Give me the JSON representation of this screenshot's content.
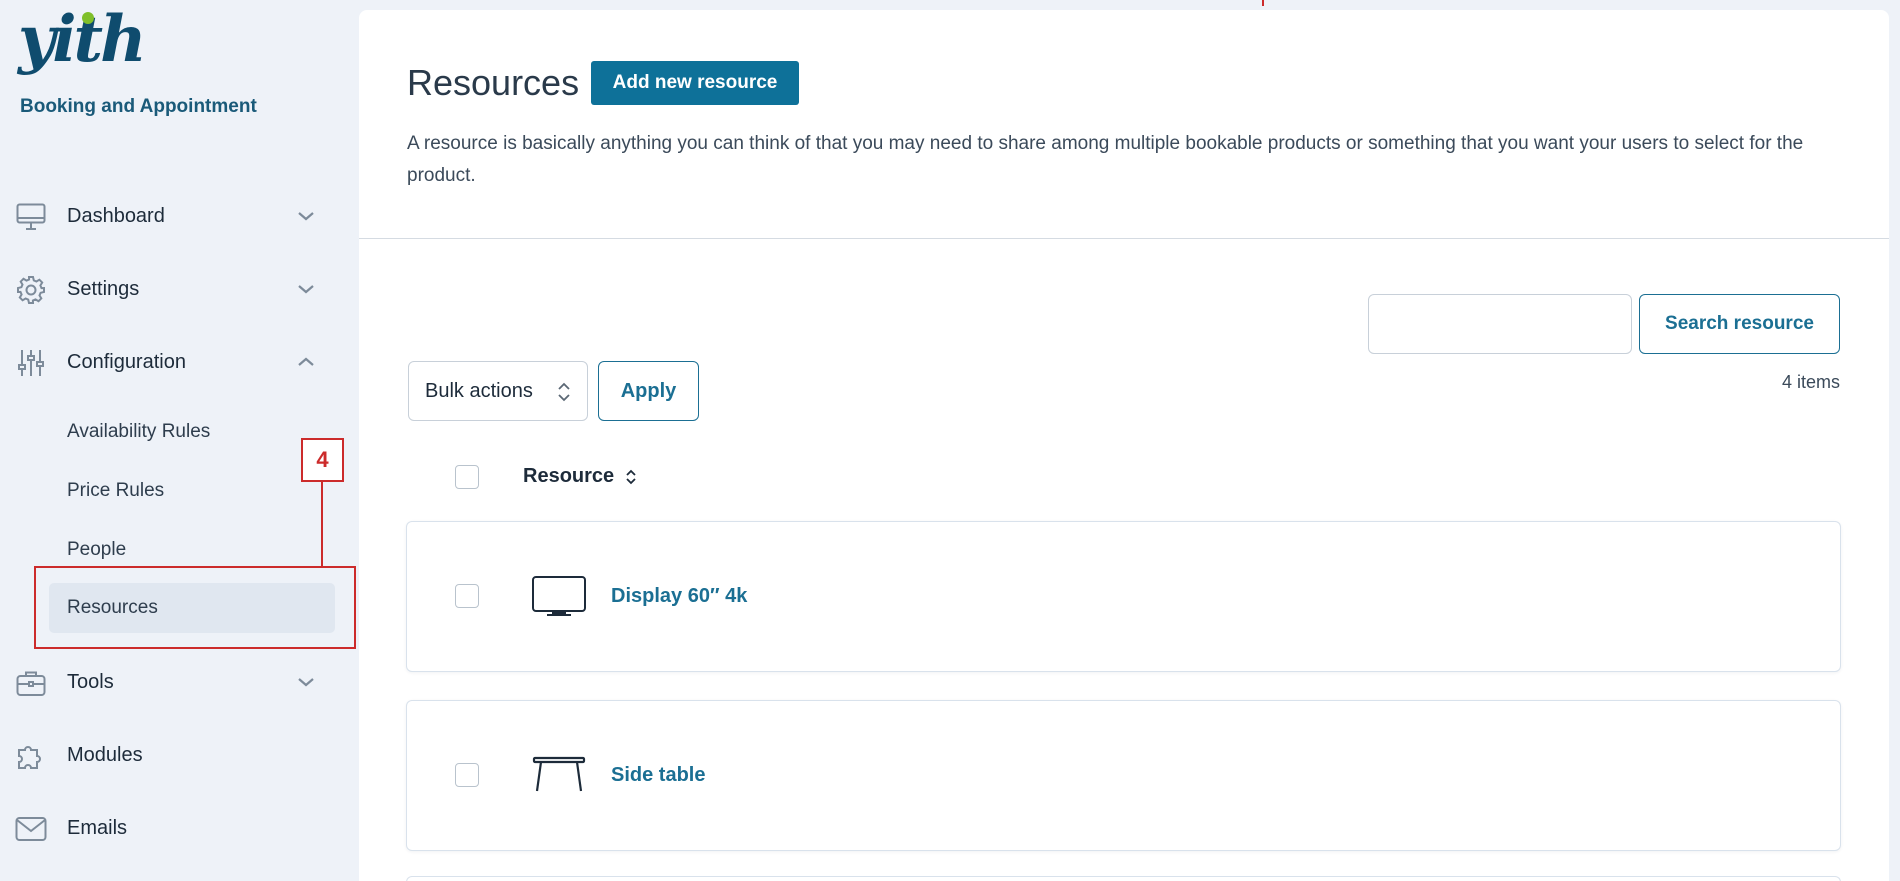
{
  "brand": {
    "logo_text": "yith",
    "subtitle": "Booking and Appointment"
  },
  "sidebar": {
    "items": [
      {
        "label": "Dashboard",
        "icon": "monitor-icon",
        "expanded": false
      },
      {
        "label": "Settings",
        "icon": "gear-icon",
        "expanded": false
      },
      {
        "label": "Configuration",
        "icon": "sliders-icon",
        "expanded": true
      },
      {
        "label": "Tools",
        "icon": "briefcase-icon",
        "expanded": false
      },
      {
        "label": "Modules",
        "icon": "puzzle-icon",
        "expanded": false
      },
      {
        "label": "Emails",
        "icon": "envelope-icon",
        "expanded": false
      }
    ],
    "configuration_children": [
      {
        "label": "Availability Rules"
      },
      {
        "label": "Price Rules"
      },
      {
        "label": "People"
      },
      {
        "label": "Resources",
        "active": true
      }
    ]
  },
  "annotation": {
    "badge": "4",
    "color": "#cc2b2b"
  },
  "main": {
    "title": "Resources",
    "add_button": "Add new resource",
    "description": "A resource is basically anything you can think of that you may need to share among multiple bookable products or something that you want your users to select for the product.",
    "search": {
      "value": "",
      "placeholder": "",
      "button": "Search resource"
    },
    "bulk_actions": {
      "selected": "Bulk actions",
      "apply": "Apply"
    },
    "items_count": "4 items",
    "table": {
      "column": "Resource",
      "rows": [
        {
          "name": "Display 60″ 4k",
          "icon": "monitor-icon"
        },
        {
          "name": "Side table",
          "icon": "side-table-icon"
        }
      ]
    }
  },
  "colors": {
    "accent": "#0e7199",
    "link": "#1b6f93",
    "sidebar_bg": "#eef2f8",
    "active_bg": "#e0e7f0"
  }
}
